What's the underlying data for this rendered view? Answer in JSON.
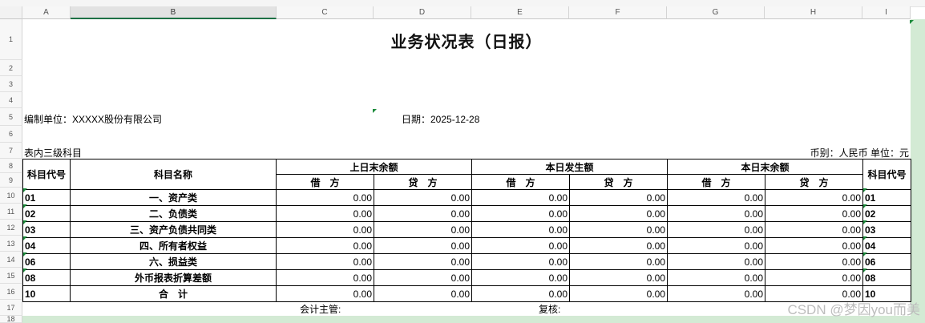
{
  "columns": [
    "A",
    "B",
    "C",
    "D",
    "E",
    "F",
    "G",
    "H",
    "I"
  ],
  "rows": [
    "1",
    "2",
    "3",
    "4",
    "5",
    "6",
    "7",
    "8",
    "9",
    "10",
    "11",
    "12",
    "13",
    "14",
    "15",
    "16",
    "17",
    "18"
  ],
  "title": "业务状况表（日报）",
  "unit_label": "编制单位：XXXXX股份有限公司",
  "date_label": "日期：2025-12-28",
  "subtitle_left": "表内三级科目",
  "subtitle_right": "币别：人民币 单位：元",
  "headers": {
    "code": "科目代号",
    "name": "科目名称",
    "group1": "上日末余额",
    "group2": "本日发生额",
    "group3": "本日末余额",
    "debit": "借　方",
    "credit": "贷　方",
    "code_right": "科目代号"
  },
  "table_rows": [
    {
      "code": "01",
      "name": "一、资产类",
      "v": [
        "0.00",
        "0.00",
        "0.00",
        "0.00",
        "0.00",
        "0.00"
      ],
      "code2": "01"
    },
    {
      "code": "02",
      "name": "二、负债类",
      "v": [
        "0.00",
        "0.00",
        "0.00",
        "0.00",
        "0.00",
        "0.00"
      ],
      "code2": "02"
    },
    {
      "code": "03",
      "name": "三、资产负债共同类",
      "v": [
        "0.00",
        "0.00",
        "0.00",
        "0.00",
        "0.00",
        "0.00"
      ],
      "code2": "03"
    },
    {
      "code": "04",
      "name": "四、所有者权益",
      "v": [
        "0.00",
        "0.00",
        "0.00",
        "0.00",
        "0.00",
        "0.00"
      ],
      "code2": "04"
    },
    {
      "code": "06",
      "name": "六、损益类",
      "v": [
        "0.00",
        "0.00",
        "0.00",
        "0.00",
        "0.00",
        "0.00"
      ],
      "code2": "06"
    },
    {
      "code": "08",
      "name": "外币报表折算差额",
      "v": [
        "0.00",
        "0.00",
        "0.00",
        "0.00",
        "0.00",
        "0.00"
      ],
      "code2": "08"
    },
    {
      "code": "10",
      "name": "合　计",
      "v": [
        "0.00",
        "0.00",
        "0.00",
        "0.00",
        "0.00",
        "0.00"
      ],
      "code2": "10"
    }
  ],
  "footer": {
    "supervisor": "会计主管:",
    "reviewer": "复核:"
  },
  "watermark": "CSDN @梦因you而美",
  "colors": {
    "selected_col_accent": "#1e7145",
    "frozen_pane": "#d3ead4",
    "comment_marker": "#1b8a3a"
  }
}
